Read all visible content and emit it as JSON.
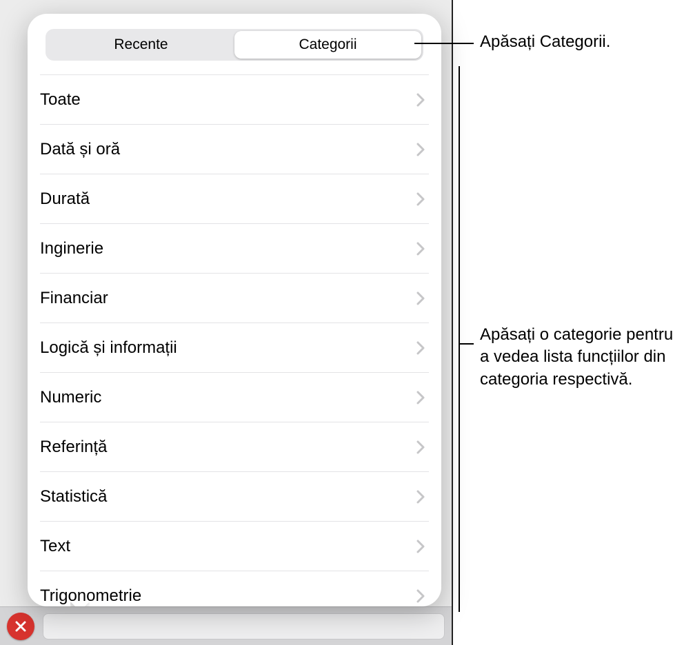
{
  "tabs": {
    "left": "Recente",
    "right": "Categorii"
  },
  "categories": [
    "Toate",
    "Dată și oră",
    "Durată",
    "Inginerie",
    "Financiar",
    "Logică și informații",
    "Numeric",
    "Referință",
    "Statistică",
    "Text",
    "Trigonometrie"
  ],
  "callouts": {
    "tap_categories": "Apăsați Categorii.",
    "tap_category_detail": "Apăsați o categorie pentru a vedea lista funcțiilor din categoria respectivă."
  }
}
